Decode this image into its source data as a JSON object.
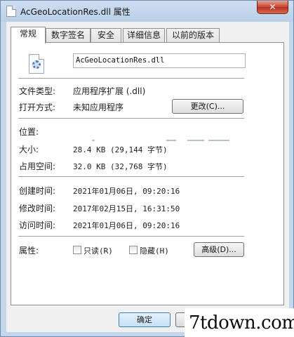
{
  "window": {
    "title": "AcGeoLocationRes.dll 属性",
    "close_label": "✕"
  },
  "tabs": [
    {
      "label": "常规",
      "active": true
    },
    {
      "label": "数字签名",
      "active": false
    },
    {
      "label": "安全",
      "active": false
    },
    {
      "label": "详细信息",
      "active": false
    },
    {
      "label": "以前的版本",
      "active": false
    }
  ],
  "general": {
    "file_name": "AcGeoLocationRes.dll",
    "file_type_label": "文件类型:",
    "file_type_value": "应用程序扩展 (.dll)",
    "opens_with_label": "打开方式:",
    "opens_with_value": "未知应用程序",
    "change_button": "更改(C)...",
    "location_label": "位置:",
    "size_label": "大小:",
    "size_value": "28.4 KB (29,144 字节)",
    "size_on_disk_label": "占用空间:",
    "size_on_disk_value": "32.0 KB (32,768 字节)",
    "created_label": "创建时间:",
    "created_value": "2021年01月06日, 09:20:16",
    "modified_label": "修改时间:",
    "modified_value": "2017年02月15日, 16:31:50",
    "accessed_label": "访问时间:",
    "accessed_value": "2021年01月06日, 09:20:16",
    "attributes_label": "属性:",
    "readonly_label": "只读(R)",
    "hidden_label": "隐藏(H)",
    "advanced_button": "高级(D)..."
  },
  "footer": {
    "ok_button": "确定"
  },
  "watermark": "7tdown.com"
}
